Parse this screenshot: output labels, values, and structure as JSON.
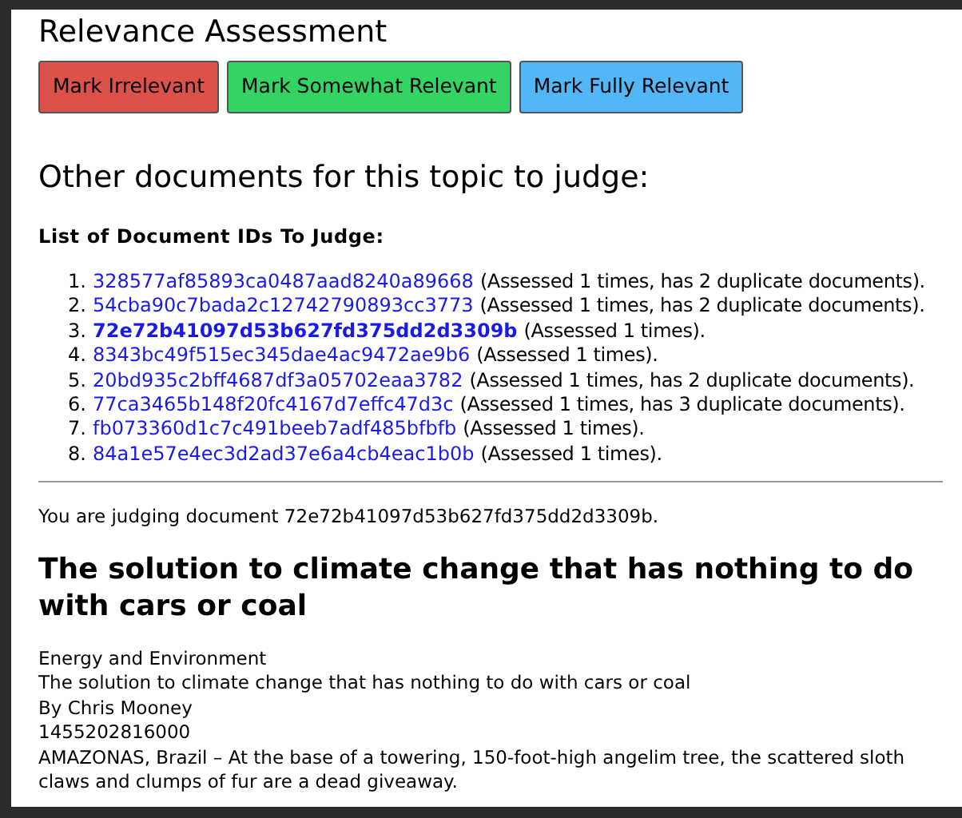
{
  "title": "Relevance Assessment",
  "buttons": [
    {
      "label": "Mark Irrelevant",
      "kind": "irrelevant"
    },
    {
      "label": "Mark Somewhat Relevant",
      "kind": "somewhat"
    },
    {
      "label": "Mark Fully Relevant",
      "kind": "fully"
    }
  ],
  "other_heading": "Other documents for this topic to judge:",
  "list_heading": "List of Document IDs To Judge:",
  "documents": [
    {
      "number": "1.",
      "id": "328577af85893ca0487aad8240a89668",
      "note": "(Assessed 1 times, has 2 duplicate documents).",
      "selected": false
    },
    {
      "number": "2.",
      "id": "54cba90c7bada2c12742790893cc3773",
      "note": "(Assessed 1 times, has 2 duplicate documents).",
      "selected": false
    },
    {
      "number": "3.",
      "id": "72e72b41097d53b627fd375dd2d3309b",
      "note": "(Assessed 1 times).",
      "selected": true
    },
    {
      "number": "4.",
      "id": "8343bc49f515ec345dae4ac9472ae9b6",
      "note": "(Assessed 1 times).",
      "selected": false
    },
    {
      "number": "5.",
      "id": "20bd935c2bff4687df3a05702eaa3782",
      "note": "(Assessed 1 times, has 2 duplicate documents).",
      "selected": false
    },
    {
      "number": "6.",
      "id": "77ca3465b148f20fc4167d7effc47d3c",
      "note": "(Assessed 1 times, has 3 duplicate documents).",
      "selected": false
    },
    {
      "number": "7.",
      "id": "fb073360d1c7c491beeb7adf485bfbfb",
      "note": "(Assessed 1 times).",
      "selected": false
    },
    {
      "number": "8.",
      "id": "84a1e57e4ec3d2ad37e6a4cb4eac1b0b",
      "note": "(Assessed 1 times).",
      "selected": false
    }
  ],
  "judging": "You are judging document 72e72b41097d53b627fd375dd2d3309b.",
  "doc_title": "The solution to climate change that has nothing to do with cars or coal",
  "doc_lines": [
    "Energy and Environment",
    "The solution to climate change that has nothing to do with cars or coal",
    "By Chris Mooney",
    "1455202816000",
    "AMAZONAS, Brazil – At the base of a towering, 150-foot-high angelim tree, the scattered sloth claws and clumps of fur are a dead giveaway."
  ]
}
